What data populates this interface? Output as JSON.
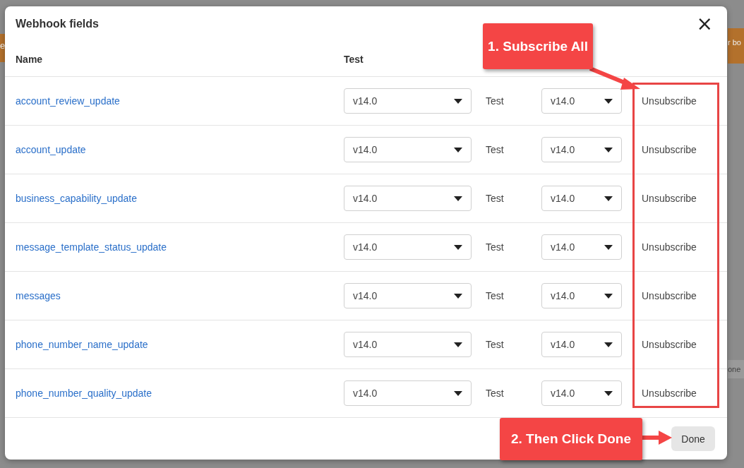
{
  "background": {
    "banner_left": "e",
    "banner_right": "r bo",
    "fragment": "one"
  },
  "dialog": {
    "title": "Webhook fields",
    "close": "×",
    "columns": [
      "Name",
      "Test"
    ],
    "fields": [
      {
        "name": "account_review_update",
        "version": "v14.0",
        "test": "Test",
        "test_version": "v14.0",
        "action": "Unsubscribe"
      },
      {
        "name": "account_update",
        "version": "v14.0",
        "test": "Test",
        "test_version": "v14.0",
        "action": "Unsubscribe"
      },
      {
        "name": "business_capability_update",
        "version": "v14.0",
        "test": "Test",
        "test_version": "v14.0",
        "action": "Unsubscribe"
      },
      {
        "name": "message_template_status_update",
        "version": "v14.0",
        "test": "Test",
        "test_version": "v14.0",
        "action": "Unsubscribe"
      },
      {
        "name": "messages",
        "version": "v14.0",
        "test": "Test",
        "test_version": "v14.0",
        "action": "Unsubscribe"
      },
      {
        "name": "phone_number_name_update",
        "version": "v14.0",
        "test": "Test",
        "test_version": "v14.0",
        "action": "Unsubscribe"
      },
      {
        "name": "phone_number_quality_update",
        "version": "v14.0",
        "test": "Test",
        "test_version": "v14.0",
        "action": "Unsubscribe"
      }
    ],
    "done": "Done"
  },
  "annotations": [
    {
      "text": "1. Subscribe All"
    },
    {
      "text": "2. Then Click Done"
    }
  ]
}
